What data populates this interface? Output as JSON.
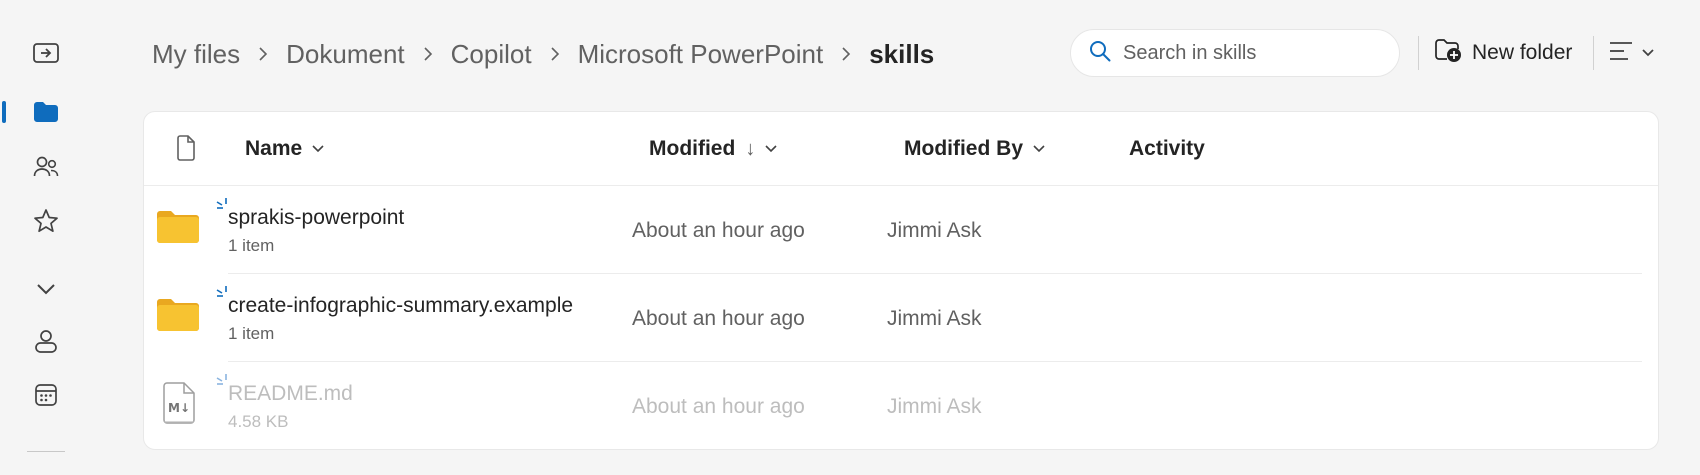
{
  "breadcrumb": [
    "My files",
    "Dokument",
    "Copilot",
    "Microsoft PowerPoint",
    "skills"
  ],
  "search": {
    "placeholder": "Search in skills"
  },
  "toolbar": {
    "new_folder_label": "New folder"
  },
  "columns": {
    "name": "Name",
    "modified": "Modified",
    "modified_sort_arrow": "↓",
    "modified_by": "Modified By",
    "activity": "Activity"
  },
  "files": [
    {
      "name": "sprakis-powerpoint",
      "detail": "1 item",
      "modified": "About an hour ago",
      "modified_by": "Jimmi Ask",
      "type": "folder"
    },
    {
      "name": "create-infographic-summary.example",
      "detail": "1 item",
      "modified": "About an hour ago",
      "modified_by": "Jimmi Ask",
      "type": "folder"
    },
    {
      "name": "README.md",
      "detail": "4.58 KB",
      "modified": "About an hour ago",
      "modified_by": "Jimmi Ask",
      "type": "markdown"
    }
  ],
  "colors": {
    "accent": "#0f6cbd",
    "folder": "#f7c331"
  }
}
